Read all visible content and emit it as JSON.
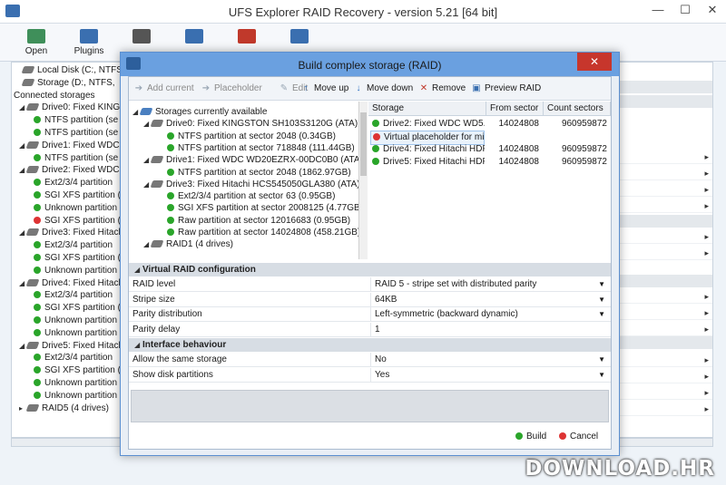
{
  "window": {
    "title": "UFS Explorer RAID Recovery - version 5.21 [64 bit]",
    "controls": [
      "—",
      "☐",
      "✕"
    ]
  },
  "toolbar": {
    "items": [
      {
        "label": "Open",
        "color": "#3f8f5a"
      },
      {
        "label": "Plugins",
        "color": "#3a6fb0"
      },
      {
        "label": "",
        "color": "#555555"
      },
      {
        "label": "",
        "color": "#3a6fb0"
      },
      {
        "label": "",
        "color": "#c0392b"
      },
      {
        "label": "",
        "color": "#3a6fb0"
      }
    ]
  },
  "left_tree": {
    "rows": [
      {
        "text": "Local Disk (C:, NTFS,",
        "kind": "drive",
        "indent": 12
      },
      {
        "text": "Storage (D:, NTFS,",
        "kind": "drive",
        "indent": 12
      },
      {
        "text": "Connected storages",
        "kind": "group",
        "indent": 2
      },
      {
        "text": "Drive0: Fixed KINGS",
        "kind": "drive",
        "indent": 8,
        "arrow": "◢"
      },
      {
        "text": "NTFS partition (se",
        "kind": "g",
        "indent": 24
      },
      {
        "text": "NTFS partition (se",
        "kind": "g",
        "indent": 24
      },
      {
        "text": "Drive1: Fixed WDC",
        "kind": "drive",
        "indent": 8,
        "arrow": "◢"
      },
      {
        "text": "NTFS partition (se",
        "kind": "g",
        "indent": 24
      },
      {
        "text": "Drive2: Fixed WDC",
        "kind": "drive",
        "indent": 8,
        "arrow": "◢"
      },
      {
        "text": "Ext2/3/4 partition",
        "kind": "g",
        "indent": 24
      },
      {
        "text": "SGI XFS partition (",
        "kind": "g",
        "indent": 24
      },
      {
        "text": "Unknown partition",
        "kind": "g",
        "indent": 24
      },
      {
        "text": "SGI XFS partition (",
        "kind": "r",
        "indent": 24
      },
      {
        "text": "Drive3: Fixed Hitach",
        "kind": "drive",
        "indent": 8,
        "arrow": "◢"
      },
      {
        "text": "Ext2/3/4 partition",
        "kind": "g",
        "indent": 24
      },
      {
        "text": "SGI XFS partition (",
        "kind": "g",
        "indent": 24
      },
      {
        "text": "Unknown partition",
        "kind": "g",
        "indent": 24
      },
      {
        "text": "Drive4: Fixed Hitach",
        "kind": "drive",
        "indent": 8,
        "arrow": "◢"
      },
      {
        "text": "Ext2/3/4 partition",
        "kind": "g",
        "indent": 24
      },
      {
        "text": "SGI XFS partition (",
        "kind": "g",
        "indent": 24
      },
      {
        "text": "Unknown partition",
        "kind": "g",
        "indent": 24
      },
      {
        "text": "Unknown partition",
        "kind": "g",
        "indent": 24
      },
      {
        "text": "Drive5: Fixed Hitach",
        "kind": "drive",
        "indent": 8,
        "arrow": "◢"
      },
      {
        "text": "Ext2/3/4 partition",
        "kind": "g",
        "indent": 24
      },
      {
        "text": "SGI XFS partition (",
        "kind": "g",
        "indent": 24
      },
      {
        "text": "Unknown partition",
        "kind": "g",
        "indent": 24
      },
      {
        "text": "Unknown partition",
        "kind": "g",
        "indent": 24
      },
      {
        "text": "RAID5 (4 drives)",
        "kind": "drive",
        "indent": 8,
        "arrow": "▸"
      }
    ]
  },
  "dialog": {
    "title": "Build complex storage (RAID)",
    "close": "✕",
    "toolbar": [
      {
        "label": "Add current",
        "icon": "➔",
        "disabled": true,
        "color": "#3a6fb0"
      },
      {
        "label": "Placeholder",
        "icon": "➔",
        "disabled": true,
        "color": "#c0392b"
      },
      {
        "label": "Edit",
        "icon": "✎",
        "disabled": true,
        "color": "#777777"
      },
      {
        "label": "Move up",
        "icon": "↑",
        "disabled": false,
        "color": "#2d6fc0"
      },
      {
        "label": "Move down",
        "icon": "↓",
        "disabled": false,
        "color": "#2d6fc0"
      },
      {
        "label": "Remove",
        "icon": "✕",
        "disabled": false,
        "color": "#c0392b"
      },
      {
        "label": "Preview RAID",
        "icon": "▣",
        "disabled": false,
        "color": "#3a6fb0"
      }
    ],
    "storage_tree": [
      {
        "text": "Storages currently available",
        "kind": "group",
        "indent": 4,
        "arrow": "◢"
      },
      {
        "text": "Drive0: Fixed KINGSTON SH103S3120G (ATA)",
        "kind": "drive",
        "indent": 16,
        "arrow": "◢"
      },
      {
        "text": "NTFS partition at sector 2048 (0.34GB)",
        "kind": "g",
        "indent": 42
      },
      {
        "text": "NTFS partition at sector 718848 (111.44GB)",
        "kind": "g",
        "indent": 42
      },
      {
        "text": "Drive1: Fixed WDC WD20EZRX-00DC0B0 (ATA)",
        "kind": "drive",
        "indent": 16,
        "arrow": "◢"
      },
      {
        "text": "NTFS partition at sector 2048 (1862.97GB)",
        "kind": "g",
        "indent": 42
      },
      {
        "text": "Drive3: Fixed Hitachi HCS545050GLA380 (ATA)",
        "kind": "drive",
        "indent": 16,
        "arrow": "◢"
      },
      {
        "text": "Ext2/3/4 partition at sector 63 (0.95GB)",
        "kind": "g",
        "indent": 42
      },
      {
        "text": "SGI XFS partition at sector 2008125 (4.77GB)",
        "kind": "g",
        "indent": 42
      },
      {
        "text": "Raw partition at sector 12016683 (0.95GB)",
        "kind": "g",
        "indent": 42
      },
      {
        "text": "Raw partition at sector 14024808 (458.21GB)",
        "kind": "g",
        "indent": 42
      },
      {
        "text": "RAID1 (4 drives)",
        "kind": "drive",
        "indent": 16,
        "arrow": "◢"
      }
    ],
    "raid_table": {
      "columns": [
        "Storage",
        "From sector",
        "Count sectors"
      ],
      "rows": [
        {
          "storage": "Drive2: Fixed WDC WD5...",
          "from": "14024808",
          "count": "960959872",
          "dot": "g",
          "selected": false
        },
        {
          "storage": "Virtual placeholder for mi...",
          "from": "",
          "count": "",
          "dot": "r",
          "selected": true
        },
        {
          "storage": "Drive4: Fixed Hitachi HDP...",
          "from": "14024808",
          "count": "960959872",
          "dot": "g",
          "selected": false
        },
        {
          "storage": "Drive5: Fixed Hitachi HDP...",
          "from": "14024808",
          "count": "960959872",
          "dot": "g",
          "selected": false
        }
      ]
    },
    "sections": [
      {
        "title": "Virtual RAID configuration",
        "arrow": "◢",
        "props": [
          {
            "key": "RAID level",
            "value": "RAID 5 - stripe set with distributed parity",
            "dropdown": true
          },
          {
            "key": "Stripe size",
            "value": "64KB",
            "dropdown": true
          },
          {
            "key": "Parity distribution",
            "value": "Left-symmetric (backward dynamic)",
            "dropdown": true
          },
          {
            "key": "Parity delay",
            "value": "1",
            "dropdown": false
          }
        ]
      },
      {
        "title": "Interface behaviour",
        "arrow": "◢",
        "props": [
          {
            "key": "Allow the same storage",
            "value": "No",
            "dropdown": true
          },
          {
            "key": "Show disk partitions",
            "value": "Yes",
            "dropdown": true
          }
        ]
      }
    ],
    "footer": {
      "build": "Build",
      "cancel": "Cancel"
    }
  },
  "watermark": "DOWNLOAD.HR"
}
